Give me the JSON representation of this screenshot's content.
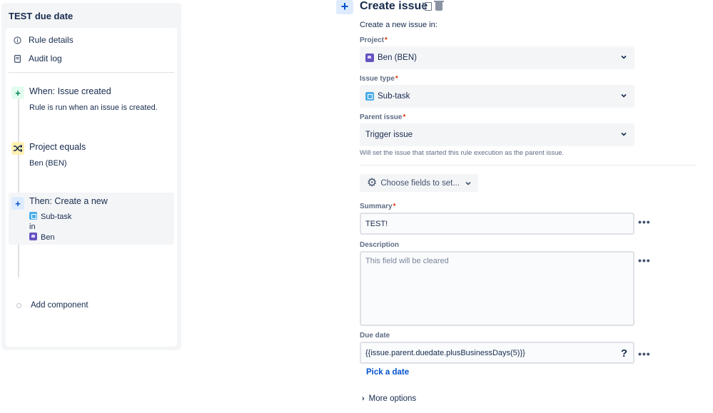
{
  "sidebar": {
    "title": "TEST due date",
    "links": [
      {
        "label": "Rule details",
        "icon": "info-icon"
      },
      {
        "label": "Audit log",
        "icon": "document-icon"
      }
    ],
    "trigger": {
      "title": "When: Issue created",
      "description": "Rule is run when an issue is created."
    },
    "condition": {
      "title": "Project equals",
      "value": "Ben (BEN)"
    },
    "action": {
      "title": "Then: Create a new",
      "issue_type": "Sub-task",
      "connector": "in",
      "project": "Ben"
    },
    "add_component": "Add component"
  },
  "form": {
    "title": "Create issue",
    "intro": "Create a new issue in:",
    "project": {
      "label": "Project",
      "value": "Ben (BEN)"
    },
    "issue_type": {
      "label": "Issue type",
      "value": "Sub-task"
    },
    "parent_issue": {
      "label": "Parent issue",
      "value": "Trigger issue",
      "helper": "Will set the issue that started this rule execution as the parent issue."
    },
    "choose_fields": "Choose fields to set...",
    "summary": {
      "label": "Summary",
      "value": "TEST!"
    },
    "description": {
      "label": "Description",
      "placeholder": "This field will be cleared"
    },
    "due_date": {
      "label": "Due date",
      "value": "{{issue.parent.duedate.plusBusinessDays(5)}}",
      "help": "?"
    },
    "pick_date": "Pick a date",
    "more_options": "More options",
    "required_mark": "*",
    "more_mark": "•••"
  },
  "colors": {
    "accent": "#0052cc",
    "trigger_badge": "#e3fcef",
    "condition_badge": "#fff0b3",
    "action_badge": "#deebff"
  }
}
